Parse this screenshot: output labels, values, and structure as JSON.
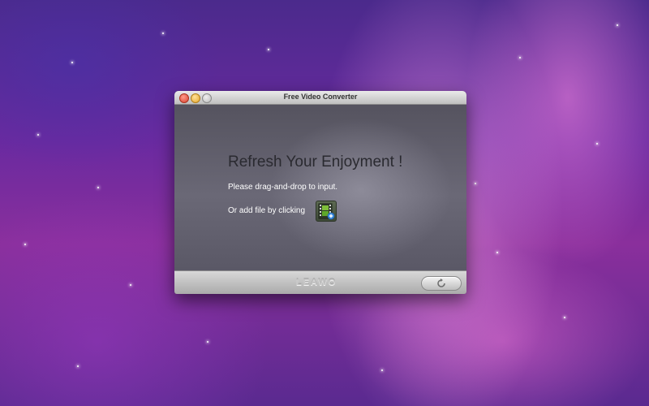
{
  "window": {
    "title": "Free Video Converter"
  },
  "main": {
    "headline": "Refresh Your Enjoyment !",
    "drag_hint": "Please drag-and-drop to input.",
    "add_hint": "Or add file by clicking"
  },
  "footer": {
    "logo": "LEAWO"
  },
  "icons": {
    "add_file": "add-video-file-icon",
    "convert": "refresh-icon"
  },
  "colors": {
    "content_bg": "#5c5a67",
    "headline": "#2a2a30",
    "close": "#d9412e",
    "minimize": "#e4a62b",
    "zoom": "#b9b9b9"
  }
}
